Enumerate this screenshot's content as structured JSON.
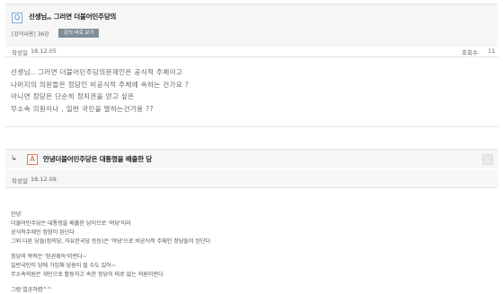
{
  "question": {
    "badge": "Q",
    "title": "선생님,, 그러면 더불어민주당의",
    "lecture_meta": "[강의내용] 36강",
    "lecture_button": "강의 바로 보기",
    "author_label": "작성일",
    "date": "18.12.05",
    "views_label": "조회수",
    "views": "11",
    "body_lines": [
      "선생님.. 그러면 더불어민주당의문제인은 공식적 주체이고",
      "나머지의 의원들은 정당인 비공식적 주체에 속하는 건가요 ?",
      "아니면 정당은 단순히 정치권을 얻고 싶은",
      "무소속 의원이나 , 일반 국민을 말하는건가용 ??"
    ]
  },
  "answer": {
    "reply_arrow": "↳",
    "badge": "A",
    "title": "안녕더불어민주당은 대통령을 배출한 당",
    "author_label": "작성일",
    "date": "18.12.09",
    "body_lines": [
      "안녕",
      "더불어민주당은 대통령을 배출한 당이므로 '여당'이라",
      "공식적주체인 정참이 된단다",
      "그외 다른 당들(정의당, 자유한국당 등등)은 '야당'으로 비공식적 주체인 정당들이 된단다",
      "",
      "정당의 목적은 '정권획득'이란다~",
      "일반국민이 당에 가입해 당원이 될 수도 있어~",
      "무소속의원은 개인으로 활동하고 속한 정당이 따로 없는 의원이란다",
      "",
      "그럼 열공하렴^^"
    ]
  },
  "colors": {
    "q_badge": "#3a78c2",
    "a_badge": "#d4502a",
    "header_bg": "#f6f6f6",
    "button_bg": "#7f8f99"
  }
}
